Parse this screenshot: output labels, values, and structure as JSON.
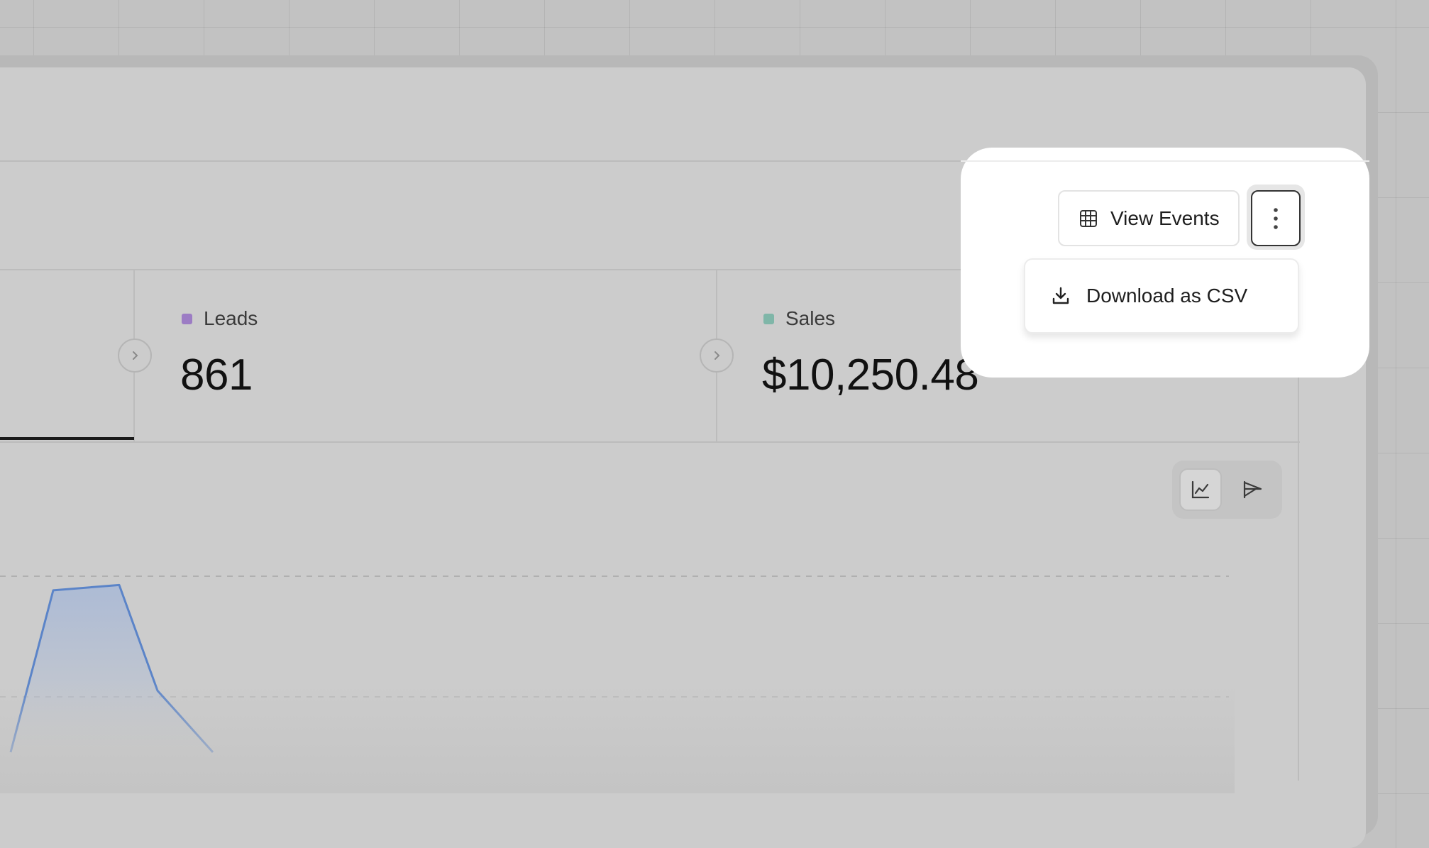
{
  "metrics": [
    {
      "label": "Leads",
      "value": "861",
      "color": "#9c7cc4"
    },
    {
      "label": "Sales",
      "value": "$10,250.48",
      "color": "#7fb6a8"
    }
  ],
  "toolbar": {
    "view_events_label": "View Events",
    "more_menu": {
      "open": true,
      "items": [
        {
          "label": "Download as CSV",
          "icon": "download-icon"
        }
      ]
    }
  },
  "chart_controls": {
    "options": [
      {
        "icon": "line-chart-icon",
        "selected": true
      },
      {
        "icon": "funnel-icon",
        "selected": false
      }
    ]
  },
  "colors": {
    "line_series": "#5b84c8",
    "active_underline": "#1a1a1a",
    "spotlight": "#ffffff"
  },
  "chart_data": {
    "type": "area",
    "title": "",
    "xlabel": "",
    "ylabel": "",
    "series": [
      {
        "values": [
          0,
          0.92,
          0.95,
          0.35,
          0
        ]
      }
    ],
    "ylim": [
      0,
      1
    ],
    "grid": true
  }
}
